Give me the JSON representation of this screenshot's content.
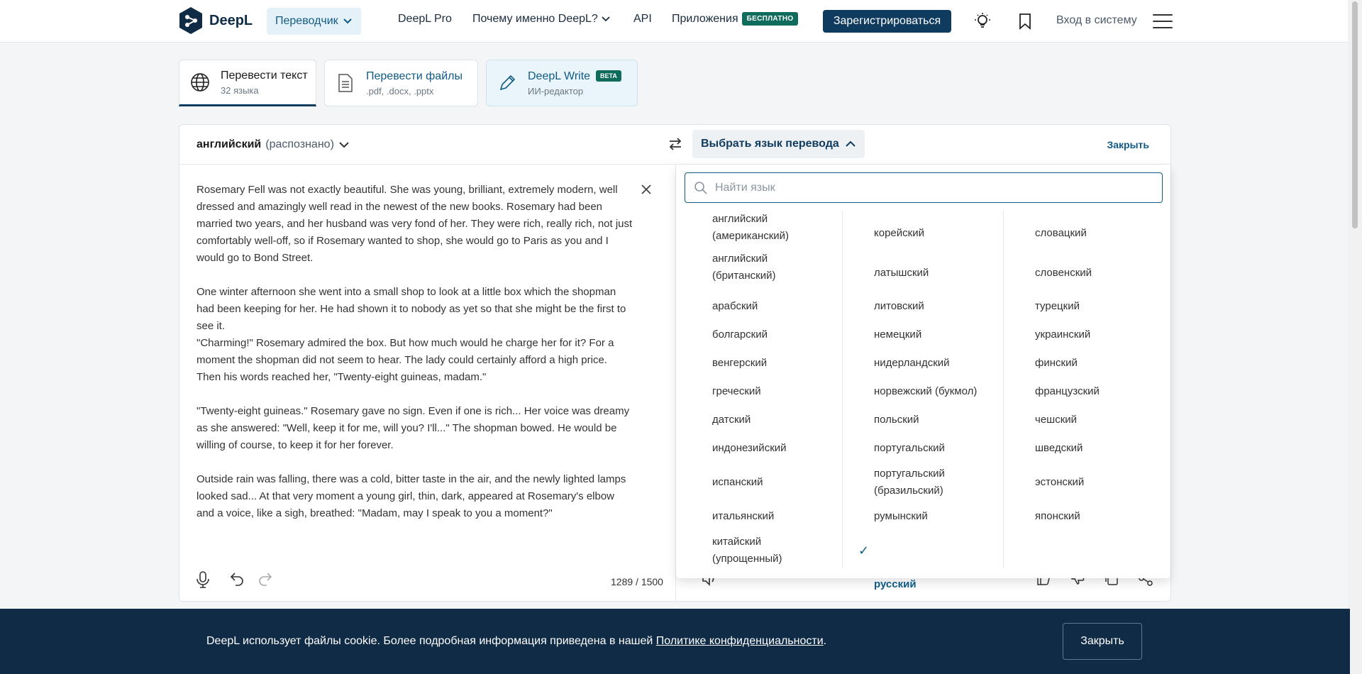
{
  "header": {
    "logo_text": "DeepL",
    "translator_label": "Переводчик",
    "pro_label": "DeepL Pro",
    "why_label": "Почему именно DeepL?",
    "api_label": "API",
    "apps_label": "Приложения",
    "free_badge": "БЕСПЛАТНО",
    "signup_label": "Зарегистрироваться",
    "login_label": "Вход в систему"
  },
  "tabs": [
    {
      "title": "Перевести текст",
      "sub": "32 языка"
    },
    {
      "title": "Перевести файлы",
      "sub": ".pdf, .docx, .pptx"
    },
    {
      "title": "DeepL Write",
      "badge": "BETA",
      "sub": "ИИ-редактор"
    }
  ],
  "toolbar": {
    "source_lang": "английский",
    "source_detected": "(распознано)",
    "target_select_label": "Выбрать язык перевода",
    "close_label": "Закрыть"
  },
  "source": {
    "text": "Rosemary Fell was not exactly beautiful. She was young, brilliant, extremely modern, well dressed and amazingly well read in the newest of the new books. Rosemary had been married two years, and her husband was very fond of her. They were rich, really rich, not just comfortably well-off, so if Rosemary wanted to shop, she would go to Paris as you and I would go to Bond Street.\n\nOne winter afternoon she went into a small shop to look at a little box which the shopman had been keeping for her. He had shown it to nobody as yet so that she might be the first to see it.\n\"Charming!\" Rosemary admired the box. But how much would he charge her for it? For a moment the shopman did not seem to hear. The lady could certainly afford a high price. Then his words reached her, \"Twenty-eight guineas, madam.\"\n\n\"Twenty-eight guineas.\" Rosemary gave no sign. Even if one is rich... Her voice was dreamy as she answered: \"Well, keep it for me, will you? I'll...\" The shopman bowed. He would be willing of course, to keep it for her forever.\n\nOutside rain was falling, there was a cold, bitter taste in the air, and the newly lighted lamps looked sad... At that very moment a young girl, thin, dark, appeared at Rosemary's elbow and a voice, like a sigh, breathed: \"Madam, may I speak to you a moment?\"",
    "char_count": "1289 / 1500"
  },
  "language_picker": {
    "search_placeholder": "Найти язык",
    "columns": [
      [
        "английский\n(американский)",
        "английский\n(британский)",
        "арабский",
        "болгарский",
        "венгерский",
        "греческий",
        "датский",
        "индонезийский",
        "испанский",
        "итальянский",
        "китайский\n(упрощенный)"
      ],
      [
        "корейский",
        "латышский",
        "литовский",
        "немецкий",
        "нидерландский",
        "норвежский (букмол)",
        "польский",
        "португальский",
        "португальский\n(бразильский)",
        "румынский",
        "русский"
      ],
      [
        "словацкий",
        "словенский",
        "турецкий",
        "украинский",
        "финский",
        "французский",
        "чешский",
        "шведский",
        "эстонский",
        "японский"
      ]
    ],
    "selected": "русский"
  },
  "cookie": {
    "text": "DeepL использует файлы cookie. Более подробная информация приведена в нашей ",
    "link": "Политике конфиденциальности",
    "end": ".",
    "close_label": "Закрыть"
  },
  "colors": {
    "brand_navy": "#0f2b46",
    "accent_blue": "#0f5b85",
    "badge_green": "#0f6b5c"
  }
}
